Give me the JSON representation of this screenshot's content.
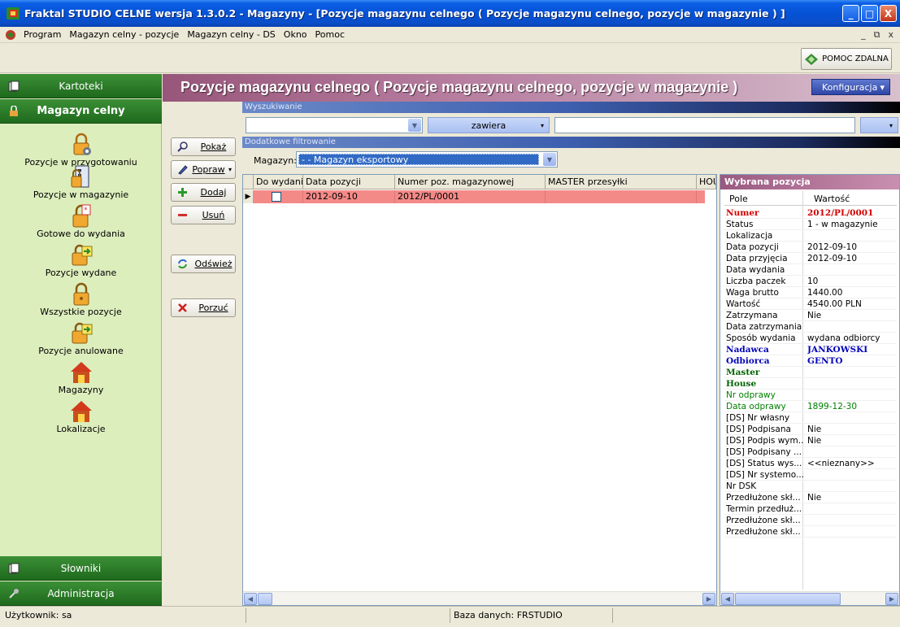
{
  "window": {
    "title": "Fraktal STUDIO CELNE  wersja 1.3.0.2 - Magazyny - [Pozycje magazynu celnego ( Pozycje magazynu celnego, pozycje w magazynie ) ]",
    "controls": [
      "_",
      "□",
      "X"
    ]
  },
  "menu": {
    "items": [
      "Program",
      "Magazyn celny - pozycje",
      "Magazyn celny - DS",
      "Okno",
      "Pomoc"
    ],
    "mdi_controls": [
      "_",
      "⧉",
      "x"
    ]
  },
  "toolbar": {
    "help_label": "POMOC ZDALNA"
  },
  "sidebar": {
    "headers": {
      "kartoteki": "Kartoteki",
      "magazyn": "Magazyn celny",
      "slowniki": "Słowniki",
      "administracja": "Administracja"
    },
    "items": [
      {
        "label": "Pozycje w przygotowaniu",
        "icon": "lock-gear-icon"
      },
      {
        "label": "Pozycje w magazynie",
        "icon": "lock-list-icon"
      },
      {
        "label": "Gotowe do wydania",
        "icon": "lock-star-icon"
      },
      {
        "label": "Pozycje wydane",
        "icon": "lock-arrow-icon"
      },
      {
        "label": "Wszystkie pozycje",
        "icon": "lock-icon"
      },
      {
        "label": "Pozycje anulowane",
        "icon": "lock-arrow-icon"
      },
      {
        "label": "Magazyny",
        "icon": "warehouse-icon"
      },
      {
        "label": "Lokalizacje",
        "icon": "warehouse-icon"
      }
    ]
  },
  "main": {
    "title": "Pozycje magazynu celnego ( Pozycje magazynu celnego, pozycje w magazynie )",
    "config_label": "Konfiguracja",
    "search_section": "Wyszukiwanie",
    "search_mode": "zawiera",
    "filter_section": "Dodatkowe filtrowanie",
    "magazyn_label": "Magazyn:",
    "magazyn_value": "- - Magazyn eksportowy"
  },
  "actions": {
    "pokaz": "Pokaż",
    "popraw": "Popraw",
    "dodaj": "Dodaj",
    "usun": "Usuń",
    "odswiez": "Odśwież",
    "porzuc": "Porzuć"
  },
  "grid": {
    "columns": [
      "Do wydania",
      "Data pozycji",
      "Numer poz. magazynowej",
      "MASTER przesyłki",
      "HOU"
    ],
    "rows": [
      {
        "do_wydania": "",
        "data": "2012-09-10",
        "numer": "2012/PL/0001",
        "master": "",
        "house": ""
      }
    ]
  },
  "selected": {
    "title": "Wybrana pozycja",
    "col_pole": "Pole",
    "col_wartosc": "Wartość",
    "rows": [
      {
        "k": "Numer",
        "v": "2012/PL/0001",
        "style": "red"
      },
      {
        "k": "Status",
        "v": "1 - w magazynie",
        "style": ""
      },
      {
        "k": "Lokalizacja",
        "v": "",
        "style": ""
      },
      {
        "k": "Data pozycji",
        "v": "2012-09-10",
        "style": ""
      },
      {
        "k": "Data przyjęcia",
        "v": "2012-09-10",
        "style": ""
      },
      {
        "k": "Data wydania",
        "v": "",
        "style": ""
      },
      {
        "k": "Liczba paczek",
        "v": "10",
        "style": ""
      },
      {
        "k": "Waga brutto",
        "v": "1440.00",
        "style": ""
      },
      {
        "k": "Wartość",
        "v": "4540.00 PLN",
        "style": ""
      },
      {
        "k": "Zatrzymana",
        "v": "Nie",
        "style": ""
      },
      {
        "k": "Data zatrzymania",
        "v": "",
        "style": ""
      },
      {
        "k": "Sposób wydania",
        "v": "wydana odbiorcy",
        "style": ""
      },
      {
        "k": "Nadawca",
        "v": "JANKOWSKI",
        "style": "blue"
      },
      {
        "k": "Odbiorca",
        "v": "GENTO",
        "style": "blue"
      },
      {
        "k": "Master",
        "v": "",
        "style": "greenb"
      },
      {
        "k": "House",
        "v": "",
        "style": "greenb"
      },
      {
        "k": "Nr odprawy",
        "v": "",
        "style": "green"
      },
      {
        "k": "Data odprawy",
        "v": "1899-12-30",
        "style": "green"
      },
      {
        "k": "[DS] Nr własny",
        "v": "",
        "style": ""
      },
      {
        "k": "[DS] Podpisana",
        "v": "Nie",
        "style": ""
      },
      {
        "k": "[DS] Podpis wym...",
        "v": "Nie",
        "style": ""
      },
      {
        "k": "[DS] Podpisany ...",
        "v": "",
        "style": ""
      },
      {
        "k": "[DS] Status wys...",
        "v": "<<nieznany>>",
        "style": ""
      },
      {
        "k": "[DS] Nr systemo...",
        "v": "",
        "style": ""
      },
      {
        "k": "Nr DSK",
        "v": "",
        "style": ""
      },
      {
        "k": "Przedłużone skł...",
        "v": "Nie",
        "style": ""
      },
      {
        "k": "Termin przedłuż...",
        "v": "",
        "style": ""
      },
      {
        "k": "Przedłużone skł...",
        "v": "",
        "style": ""
      },
      {
        "k": "Przedłużone skł...",
        "v": "",
        "style": ""
      }
    ]
  },
  "status": {
    "user": "Użytkownik: sa",
    "db": "Baza danych: FRSTUDIO"
  }
}
